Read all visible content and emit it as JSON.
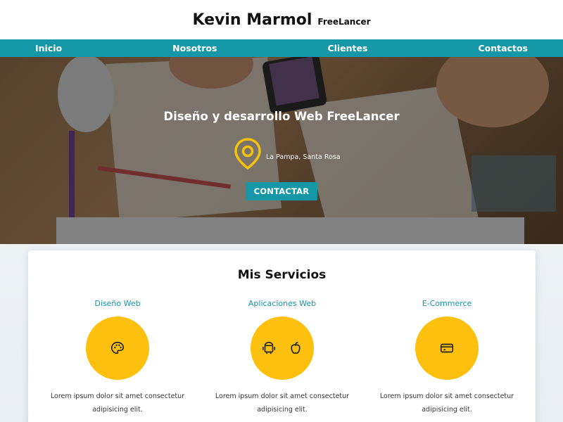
{
  "header": {
    "name": "Kevin Marmol",
    "subtitle": "FreeLancer"
  },
  "nav": {
    "items": [
      "Inicio",
      "Nosotros",
      "Clientes",
      "Contactos"
    ]
  },
  "hero": {
    "title": "Diseño y desarrollo Web FreeLancer",
    "location": "La Pampa, Santa Rosa",
    "cta_label": "CONTACTAR"
  },
  "services": {
    "title": "Mis Servicios",
    "items": [
      {
        "title": "Diseño Web",
        "icons": [
          "palette-icon"
        ],
        "description": "Lorem ipsum dolor sit amet consectetur adipisicing elit."
      },
      {
        "title": "Aplicaciones Web",
        "icons": [
          "android-icon",
          "apple-icon"
        ],
        "description": "Lorem ipsum dolor sit amet consectetur adipisicing elit."
      },
      {
        "title": "E-Commerce",
        "icons": [
          "credit-card-icon"
        ],
        "description": "Lorem ipsum dolor sit amet consectetur adipisicing elit."
      }
    ]
  },
  "colors": {
    "accent": "#1597a8",
    "icon_circle": "#fdc00f",
    "pin": "#f4c20d"
  }
}
